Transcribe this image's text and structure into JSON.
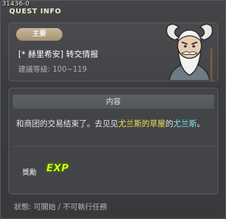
{
  "quest_id": "31436-0",
  "window_title": "QUEST INFO",
  "quest": {
    "type_label": "主要",
    "name": "[* 赫里希安] 转交情报",
    "level_range": "建議等级: 100~119",
    "portrait_icon": "npc-portrait-icon"
  },
  "content": {
    "header": "内容",
    "description_parts": [
      {
        "text": "和商团的交易结束了。去见见",
        "color": "#e6e6e6"
      },
      {
        "text": "尤兰斯的草屋",
        "color": "#f5e04a"
      },
      {
        "text": "的",
        "color": "#e6e6e6"
      },
      {
        "text": "尤兰斯",
        "color": "#7fe3f2"
      },
      {
        "text": "。",
        "color": "#e6e6e6"
      }
    ],
    "reward_label": "獎勵",
    "reward_badge": "EXP"
  },
  "status": "狀態: 可開始 / 不可執行任務",
  "colors": {
    "highlight_place": "#f5e04a",
    "highlight_npc": "#7fe3f2",
    "exp_badge": "#d9f526",
    "type_pill": "#b8a684"
  }
}
